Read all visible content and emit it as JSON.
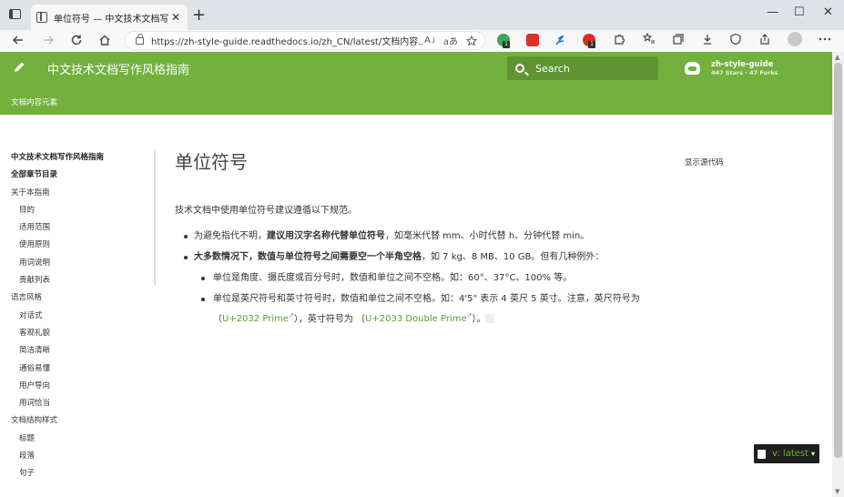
{
  "browser": {
    "tab_title": "单位符号 — 中文技术文档写作风格指南",
    "tab_close": "✕",
    "new_tab": "+",
    "url": "https://zh-style-guide.readthedocs.io/zh_CN/latest/文档内容...",
    "read_aloud": "A˩",
    "translate": "aあ",
    "minimize": "—",
    "maximize": "☐",
    "close": "✕",
    "ext_badge_1": "1",
    "ext_badge_2": "1"
  },
  "header": {
    "site_title": "中文技术文档写作风格指南",
    "search_placeholder": "Search",
    "repo_name": "zh-style-guide",
    "repo_stats": "447 Stars · 47 Forks",
    "breadcrumb": "文档内容元素"
  },
  "sidebar": {
    "items": [
      {
        "label": "中文技术文档写作风格指南",
        "level": "bold"
      },
      {
        "label": "全部章节目录",
        "level": "bold"
      },
      {
        "label": "关于本指南",
        "level": "top"
      },
      {
        "label": "目的",
        "level": "sub"
      },
      {
        "label": "适用范围",
        "level": "sub"
      },
      {
        "label": "使用原则",
        "level": "sub"
      },
      {
        "label": "用词说明",
        "level": "sub"
      },
      {
        "label": "贡献列表",
        "level": "sub"
      },
      {
        "label": "语言风格",
        "level": "top"
      },
      {
        "label": "对话式",
        "level": "sub"
      },
      {
        "label": "客观礼貌",
        "level": "sub"
      },
      {
        "label": "简洁清晰",
        "level": "sub"
      },
      {
        "label": "通俗易懂",
        "level": "sub"
      },
      {
        "label": "用户导向",
        "level": "sub"
      },
      {
        "label": "用词恰当",
        "level": "sub"
      },
      {
        "label": "文档结构样式",
        "level": "top"
      },
      {
        "label": "标题",
        "level": "sub"
      },
      {
        "label": "段落",
        "level": "sub"
      },
      {
        "label": "句子",
        "level": "sub"
      }
    ]
  },
  "main": {
    "title": "单位符号",
    "intro": "技术文档中使用单位符号建议遵循以下规范。",
    "b1_pre": "为避免指代不明，",
    "b1_bold": "建议用汉字名称代替单位符号",
    "b1_post": "，如毫米代替 mm、小时代替 h、分钟代替 min。",
    "b2_bold": "大多数情况下，数值与单位符号之间需要空一个半角空格",
    "b2_post": "，如 7 kg、8 MB、10 GB。但有几种例外：",
    "s1": "单位是角度、摄氏度或百分号时，数值和单位之间不空格。如：60°、37°C、100% 等。",
    "s2_a": "单位是英尺符号和英寸符号时，数值和单位之间不空格。如：4'5\" 表示 4 英尺 5 英寸。注意，英尺符号为 （",
    "s2_link1": "U+2032 Prime",
    "s2_b": "），英寸符号为 （",
    "s2_link2": "U+2033 Double Prime",
    "s2_c": "）。",
    "ext_mark": "↗",
    "view_source": "显示源代码"
  },
  "version": {
    "label": "v: latest",
    "caret": "▾"
  },
  "scrollbar": {
    "up": "▲",
    "down": "▼"
  },
  "colors": {
    "brand_green": "#72b13d",
    "search_bg": "#5e9431",
    "link": "#5aa02c"
  }
}
